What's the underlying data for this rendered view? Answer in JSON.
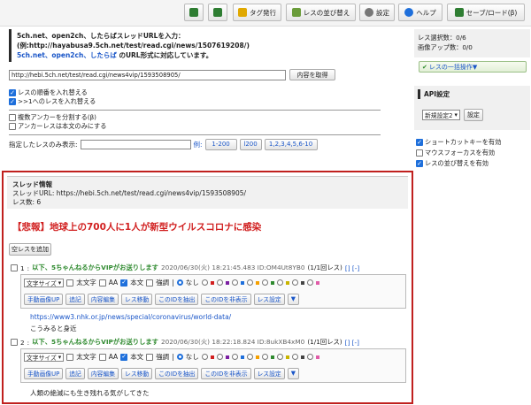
{
  "toolbar": {
    "icon1_label": "",
    "icon2_label": "",
    "tag_label": "タグ発行",
    "reorder_label": "レスの並び替え",
    "settings_label": "設定",
    "help_label": "ヘルプ",
    "saveload_label": "セーブ/ロード(β)"
  },
  "intro": {
    "line1": "5ch.net、open2ch、したらばスレッドURLを入力：",
    "line2": "(例:http://hayabusa9.5ch.net/test/read.cgi/news/1507619208/)",
    "line3a": "5ch.net、open2ch、したらば",
    "line3b": " のURL形式に対応しています。"
  },
  "url_input": {
    "value": "http://hebi.5ch.net/test/read.cgi/news4vip/1593508905/"
  },
  "fetch_button": "内容を取得",
  "options": {
    "reverse": "レスの順番を入れ替える",
    "first_ref": ">>1へのレスを入れ替える",
    "split_anchor": "複数アンカーを分割する(β)",
    "anchor_body": "アンカーレスは本文のみにする"
  },
  "range": {
    "label": "指定したレスのみ表示:",
    "example": "例:",
    "ex1": "1-200",
    "ex2": "l200",
    "ex3": "1,2,3,4,5,6-10"
  },
  "thread_info": {
    "heading": "スレッド情報",
    "url_line": "スレッドURL: https://hebi.5ch.net/test/read.cgi/news4vip/1593508905/",
    "count_line": "レス数: 6"
  },
  "thread_title": "【悲報】地球上の700人に1人が新型ウイルスコロナに感染",
  "add_empty_button": "空レスを追加",
  "posts": [
    {
      "num": "1",
      "name": "以下、5ちゃんねるからVIPがお送りします",
      "date": "2020/06/30(火) 18:21:45.483 ID:OM4Ut8YB0",
      "refs": "(1/1回レス)",
      "links": "[] [-]",
      "link": "https://www3.nhk.or.jp/news/special/coronavirus/world-data/",
      "body": "こうみると身近"
    },
    {
      "num": "2",
      "name": "以下、5ちゃんねるからVIPがお送りします",
      "date": "2020/06/30(火) 18:22:18.824 ID:8ukXB4xM0",
      "refs": "(1/1回レス)",
      "links": "[] [-]",
      "link": "",
      "body": "人類の絶滅にも生き残れる気がしてきた"
    }
  ],
  "post_controls": {
    "font_size": "文字サイズ",
    "bold": "太文字",
    "aa": "AA",
    "body": "本文",
    "emph": "強調",
    "none": "なし",
    "photo_up": "手動画像UP",
    "append": "追記",
    "edit": "内容編集",
    "move": "レス移動",
    "extract_id": "このIDを抽出",
    "hide_id": "このIDを非表示",
    "res_settings": "レス設定",
    "more": "▼"
  },
  "swatch_colors": [
    "#d11f1f",
    "#7b1fa2",
    "#1e6fdb",
    "#f5a000",
    "#2f8a2f",
    "#c8b400",
    "#444444",
    "#e05ca8"
  ],
  "sidebar": {
    "selected": "レス選択数：0/6",
    "images": "画像アップ数：0/0",
    "bulk": "レスの一括操作▼",
    "api_heading": "API設定",
    "api_select": "新規設定2",
    "api_button": "設定",
    "shortcut": "ショートカットキーを有効",
    "mouse_focus": "マウスフォーカスを有効",
    "reorder_enable": "レスの並び替えを有効"
  },
  "colors": {
    "accent_red": "#c0201e",
    "link_blue": "#1a56c8",
    "name_green": "#2f8a2f"
  }
}
